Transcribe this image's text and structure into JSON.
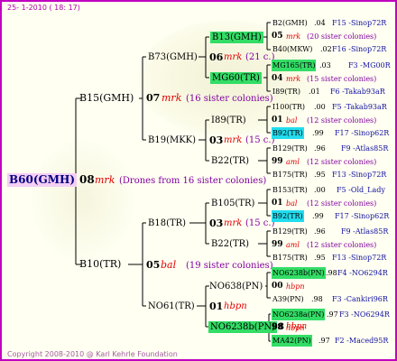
{
  "header": "25- 1-2010 ( 18: 17)",
  "copyright": "Copyright 2008-2010 @ Karl Kehrle Foundation",
  "root": {
    "id": "B60(GMH)",
    "num": "08",
    "name": "mrk",
    "note": "(Drones from 16 sister colonies)"
  },
  "gen1": [
    {
      "id": "B15(GMH)",
      "num": "07",
      "name": "mrk",
      "note": "(16 sister colonies)"
    },
    {
      "id": "B10(TR)",
      "num": "05",
      "name": "bal",
      "note": "(19 sister colonies)"
    }
  ],
  "gen2": [
    {
      "id": "B73(GMH)",
      "num": "06",
      "name": "mrk",
      "note": "(21 c.)"
    },
    {
      "id": "B19(MKK)",
      "num": "03",
      "name": "mrk",
      "note": "(15 c.)"
    },
    {
      "id": "B18(TR)",
      "num": "03",
      "name": "mrk",
      "note": "(15 c.)"
    },
    {
      "id": "NO61(TR)",
      "num": "01",
      "name": "hbpn",
      "note": ""
    }
  ],
  "gen3": [
    {
      "id": "B13(GMH)",
      "num": "",
      "name": "",
      "note": ""
    },
    {
      "id": "MG60(TR)",
      "num": "",
      "name": "",
      "note": ""
    },
    {
      "id": "I89(TR)",
      "num": "",
      "name": "",
      "note": ""
    },
    {
      "id": "B22(TR)",
      "num": "",
      "name": "",
      "note": ""
    },
    {
      "id": "B105(TR)",
      "num": "",
      "name": "",
      "note": ""
    },
    {
      "id": "B22(TR)",
      "num": "",
      "name": "",
      "note": ""
    },
    {
      "id": "NO638(PN)",
      "num": "",
      "name": "",
      "note": ""
    },
    {
      "id": "NO6238b(PN)",
      "num": "98",
      "name": "hbpn",
      "note": ""
    }
  ],
  "gen4": [
    {
      "id": "B2(GMH)",
      "score": ".04",
      "code": "F15 -Sinop72R"
    },
    {
      "num": "05",
      "name": "mrk",
      "note": "(20 sister colonies)"
    },
    {
      "id": "B40(MKW)",
      "score": ".02",
      "code": "F16 -Sinop72R"
    },
    {
      "id": "MG165(TR)",
      "score": ".03",
      "code": "F3 -MG00R"
    },
    {
      "num": "04",
      "name": "mrk",
      "note": "(15 sister colonies)"
    },
    {
      "id": "I89(TR)",
      "score": ".01",
      "code": "F6 -Takab93aR"
    },
    {
      "id": "I100(TR)",
      "score": ".00",
      "code": "F5 -Takab93aR"
    },
    {
      "num": "01",
      "name": "bal",
      "note": "(12 sister colonies)"
    },
    {
      "id": "B92(TR)",
      "score": ".99",
      "code": "F17 -Sinop62R"
    },
    {
      "id": "B129(TR)",
      "score": ".96",
      "code": "F9 -Atlas85R"
    },
    {
      "num": "99",
      "name": "aml",
      "note": "(12 sister colonies)"
    },
    {
      "id": "B175(TR)",
      "score": ".95",
      "code": "F13 -Sinop72R"
    },
    {
      "id": "B153(TR)",
      "score": ".00",
      "code": "F5 -Old_Lady"
    },
    {
      "num": "01",
      "name": "bal",
      "note": "(12 sister colonies)"
    },
    {
      "id": "B92(TR)",
      "score": ".99",
      "code": "F17 -Sinop62R"
    },
    {
      "id": "B129(TR)",
      "score": ".96",
      "code": "F9 -Atlas85R"
    },
    {
      "num": "99",
      "name": "aml",
      "note": "(12 sister colonies)"
    },
    {
      "id": "B175(TR)",
      "score": ".95",
      "code": "F13 -Sinop72R"
    },
    {
      "id": "NO6238b(PN)",
      "score": ".98",
      "code": "F4 -NO6294R"
    },
    {
      "num": "00",
      "name": "hbpn",
      "note": ""
    },
    {
      "id": "A39(PN)",
      "score": ".98",
      "code": "F3 -Cankiri96R"
    },
    {
      "id": "NO6238a(PN)",
      "score": ".97",
      "code": "F3 -NO6294R"
    },
    {
      "num": "98",
      "name": "hbpn",
      "note": ""
    },
    {
      "id": "MA42(PN)",
      "score": ".97",
      "code": "F2 -Maced95R"
    }
  ],
  "colors": {
    "frame": "#c000c0",
    "highlight_green": "#33dd66",
    "highlight_cyan": "#22ddee",
    "root_bg": "#f4cff4",
    "mrk": "#e00000",
    "notes": "#8000a0"
  }
}
